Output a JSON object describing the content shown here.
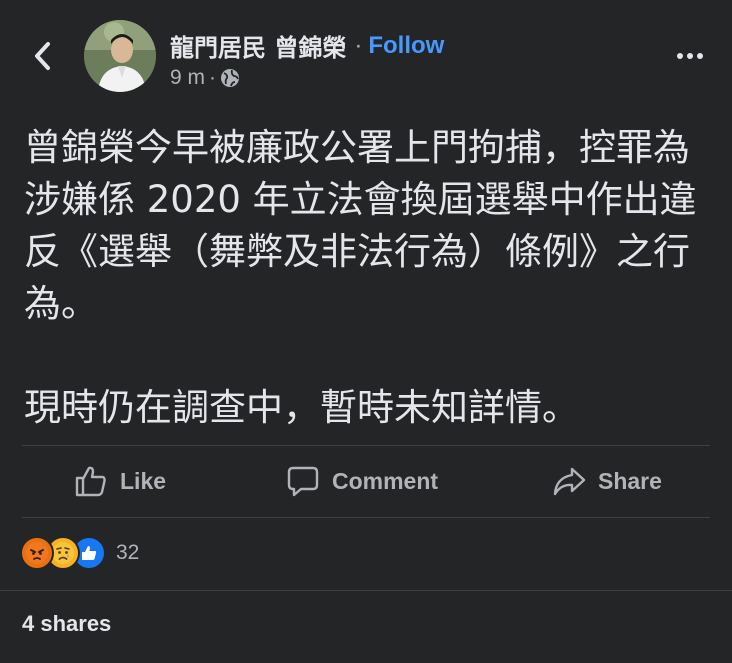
{
  "header": {
    "author": "龍門居民 曾錦榮",
    "separator": "·",
    "follow_label": "Follow",
    "time": "9 m",
    "meta_separator": "·",
    "privacy_icon": "globe-icon",
    "back_icon": "chevron-left-icon",
    "more_icon": "more-horizontal-icon"
  },
  "post": {
    "paragraph1": "曾錦榮今早被廉政公署上門拘捕，控罪為涉嫌係 2020 年立法會換屆選舉中作出違反《選舉（舞弊及非法行為）條例》之行為。",
    "paragraph2": "現時仍在調查中，暫時未知詳情。"
  },
  "actions": {
    "like_label": "Like",
    "comment_label": "Comment",
    "share_label": "Share"
  },
  "reactions": {
    "types": [
      "angry",
      "sad",
      "like"
    ],
    "count": "32"
  },
  "footer": {
    "shares_label": "4 shares"
  },
  "colors": {
    "background": "#242526",
    "text": "#e4e6eb",
    "secondary": "#b0b3b8",
    "link": "#4599ff"
  }
}
